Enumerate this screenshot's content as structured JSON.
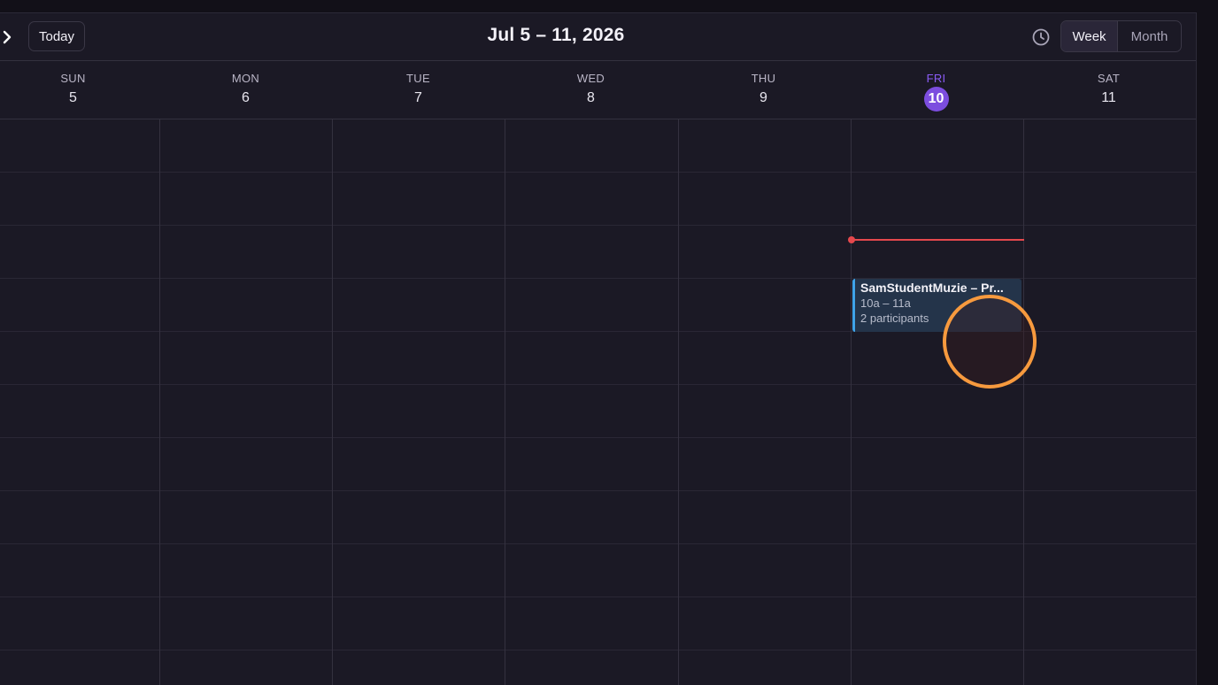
{
  "header": {
    "today_label": "Today",
    "range_title": "Jul 5 – 11, 2026",
    "views": [
      {
        "label": "Week",
        "active": true
      },
      {
        "label": "Month",
        "active": false
      }
    ],
    "icons": {
      "next": "chevron-right-icon",
      "clock": "clock-icon"
    }
  },
  "days": [
    {
      "name": "SUN",
      "num": "5",
      "today": false
    },
    {
      "name": "MON",
      "num": "6",
      "today": false
    },
    {
      "name": "TUE",
      "num": "7",
      "today": false
    },
    {
      "name": "WED",
      "num": "8",
      "today": false
    },
    {
      "name": "THU",
      "num": "9",
      "today": false
    },
    {
      "name": "FRI",
      "num": "10",
      "today": true
    },
    {
      "name": "SAT",
      "num": "11",
      "today": false
    }
  ],
  "event": {
    "title": "SamStudentMuzie – Pr...",
    "time": "10a – 11a",
    "meta": "2 participants",
    "accent_color": "#3fa4ea"
  },
  "colors": {
    "today_accent": "#7c4ddf",
    "now_indicator": "#e5484d",
    "cursor_ring": "#f79a3e"
  }
}
